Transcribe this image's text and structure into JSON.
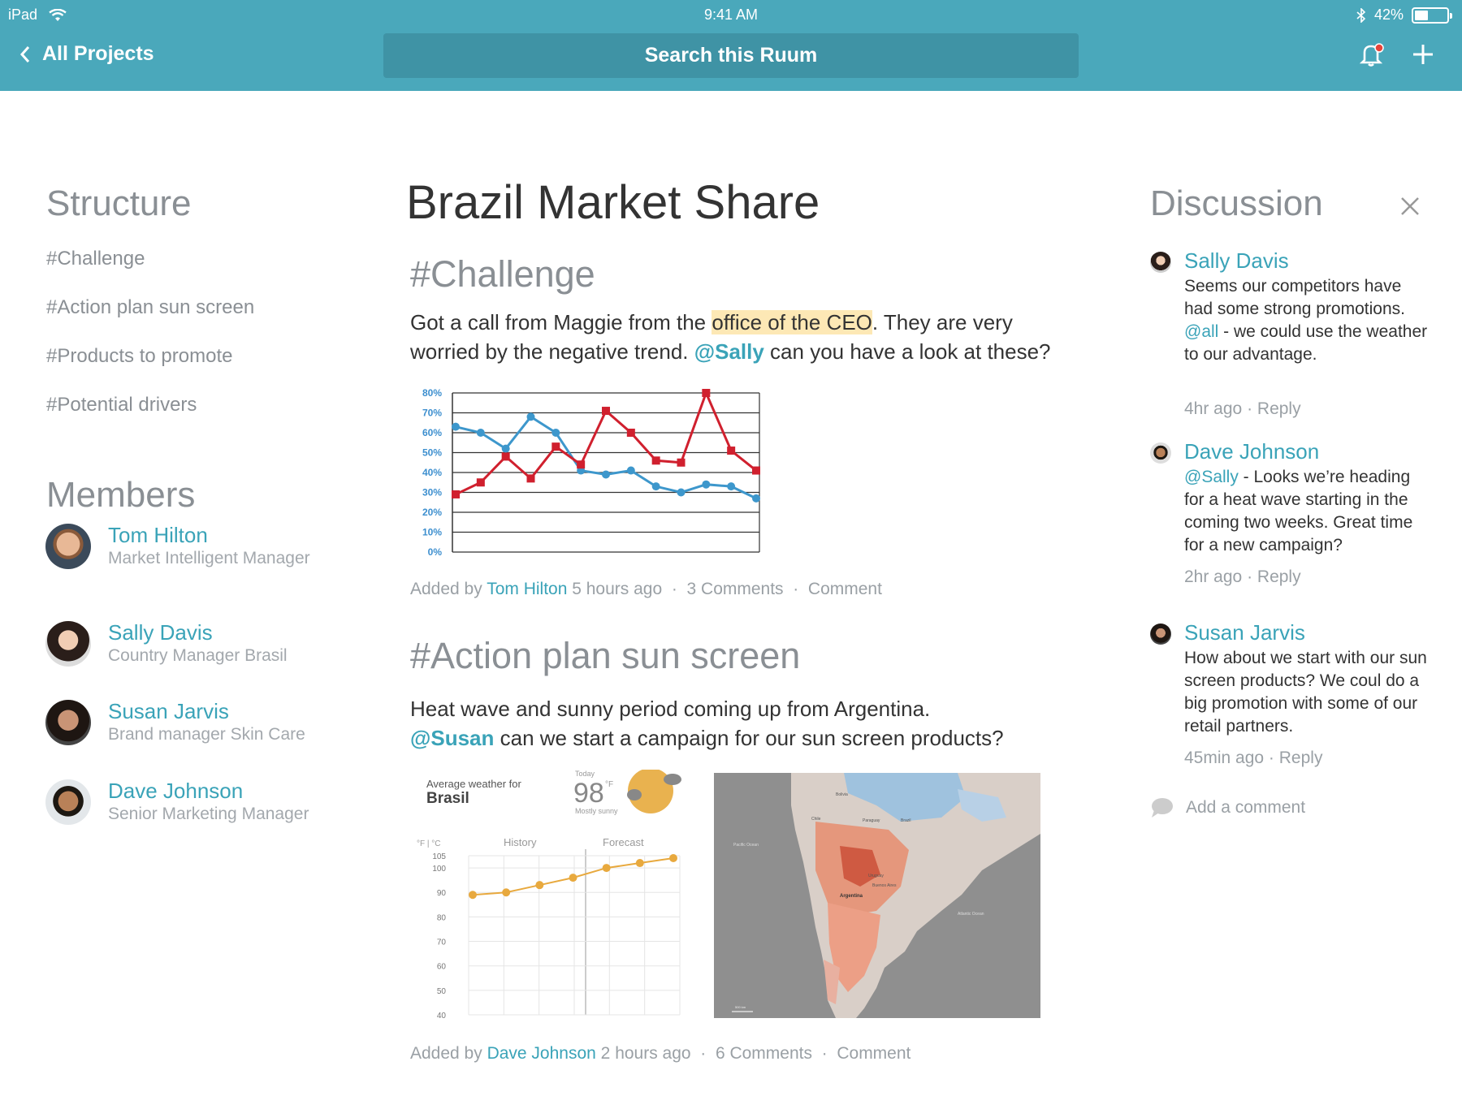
{
  "status_bar": {
    "device": "iPad",
    "time": "9:41 AM",
    "battery": "42%",
    "battery_level": 0.42
  },
  "nav": {
    "back_label": "All Projects",
    "search_label": "Search this Ruum"
  },
  "structure": {
    "heading": "Structure",
    "items": [
      {
        "label": "#Challenge"
      },
      {
        "label": "#Action plan sun screen"
      },
      {
        "label": "#Products to promote"
      },
      {
        "label": "#Potential drivers"
      }
    ]
  },
  "members": {
    "heading": "Members",
    "list": [
      {
        "name": "Tom Hilton",
        "role": "Market Intelligent Manager"
      },
      {
        "name": "Sally Davis",
        "role": "Country Manager Brasil"
      },
      {
        "name": "Susan Jarvis",
        "role": "Brand manager Skin Care"
      },
      {
        "name": "Dave Johnson",
        "role": "Senior Marketing Manager"
      }
    ]
  },
  "main": {
    "title": "Brazil Market Share",
    "sections": [
      {
        "heading": "#Challenge",
        "text_a": "Got a call from Maggie from the ",
        "text_highlight": "office of the CEO",
        "text_b": ". They are very worried by the negative trend. ",
        "mention": "@Sally",
        "text_c": " can you have a look at these?",
        "meta": {
          "prefix": "Added by ",
          "author": "Tom Hilton",
          "time": " 5 hours ago",
          "comments": "3 Comments",
          "action": "Comment"
        }
      },
      {
        "heading": "#Action plan sun screen",
        "text_a": "Heat wave and sunny period coming up from Argentina.",
        "mention": "@Susan",
        "text_c": " can we start a campaign for our sun screen products?",
        "meta": {
          "prefix": "Added by ",
          "author": "Dave Johnson",
          "time": " 2 hours ago",
          "comments": "6 Comments",
          "action": "Comment"
        }
      }
    ]
  },
  "chart_data": [
    {
      "type": "line",
      "title": "",
      "x": [
        1,
        2,
        3,
        4,
        5,
        6,
        7,
        8,
        9,
        10,
        11,
        12,
        13
      ],
      "ylim": [
        0,
        80
      ],
      "yticks": [
        "0%",
        "10%",
        "20%",
        "30%",
        "40%",
        "50%",
        "60%",
        "70%",
        "80%"
      ],
      "series": [
        {
          "values": [
            63,
            60,
            52,
            68,
            60,
            41,
            39,
            41,
            33,
            30,
            34,
            33,
            27
          ],
          "color": "#3d97cc"
        },
        {
          "values": [
            29,
            35,
            48,
            37,
            53,
            44,
            71,
            60,
            46,
            45,
            80,
            51,
            41
          ],
          "color": "#d0202e"
        }
      ]
    },
    {
      "type": "line",
      "title": "Average weather for",
      "subtitle": "Brasil",
      "today_label": "Today",
      "today_temp": "98",
      "today_unit": "°F",
      "today_desc": "Mostly sunny",
      "unit_labels": [
        "°F",
        "°C"
      ],
      "sections": [
        "History",
        "Forecast"
      ],
      "yticks": [
        "105",
        "100",
        "90",
        "80",
        "70",
        "60",
        "50",
        "40"
      ],
      "ylim": [
        40,
        105
      ],
      "series": [
        {
          "values": [
            89,
            90,
            93,
            96,
            100,
            102,
            104
          ],
          "color": "#e8a93e"
        }
      ]
    }
  ],
  "map": {
    "labels": [
      "Bolivia",
      "Chile",
      "Paraguay",
      "Brazil",
      "Pacific Ocean",
      "Uruguay",
      "Buenos Aires",
      "Argentina",
      "Atlantic Ocean",
      "500 km"
    ]
  },
  "discussion": {
    "heading": "Discussion",
    "comments": [
      {
        "name": "Sally Davis",
        "text_a": "Seems our competitors have had some strong promotions.",
        "mention": "@all",
        "text_b": " - we could use the weather to our advantage.",
        "time": "4hr ago",
        "reply": "Reply"
      },
      {
        "name": "Dave Johnson",
        "mention": "@Sally",
        "text_b": " - Looks we’re heading for a heat wave starting in the coming two weeks. Great time for a new campaign?",
        "time": "2hr ago",
        "reply": "Reply"
      },
      {
        "name": "Susan Jarvis",
        "text_a": "How about we start with our sun screen products? We coul do a big promotion with some of our retail partners.",
        "time": "45min ago",
        "reply": "Reply"
      }
    ],
    "add_comment": "Add a comment"
  },
  "colors": {
    "accent": "#4aa8bb",
    "link": "#3aa3b8",
    "muted": "#8a8f94",
    "highlight": "#fde8b5"
  }
}
